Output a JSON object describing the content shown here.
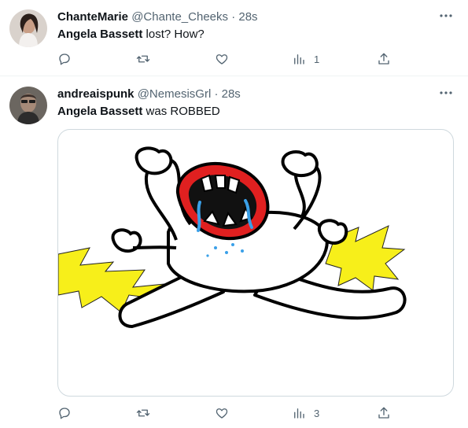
{
  "tweets": [
    {
      "display_name": "ChanteMarie",
      "handle": "@Chante_Cheeks",
      "separator": "·",
      "time": "28s",
      "text_bold": "Angela Bassett",
      "text_rest": " lost? How?",
      "avatar_icon": "user-avatar-photo",
      "views": "1"
    },
    {
      "display_name": "andreaispunk",
      "handle": "@NemesisGrl",
      "separator": "·",
      "time": "28s",
      "text_bold": "Angela Bassett",
      "text_rest": " was ROBBED",
      "avatar_icon": "user-avatar-photo",
      "media_icon": "crying-screaming-cartoon-drawing",
      "views": "3"
    }
  ],
  "icons": {
    "reply": "reply-icon",
    "retweet": "retweet-icon",
    "like": "heart-icon",
    "views": "views-chart-icon",
    "share": "share-icon",
    "more": "more-dots-icon"
  },
  "colors": {
    "text": "#0f1419",
    "secondary": "#536471",
    "border": "#eff3f4",
    "cartoon_red": "#e02020",
    "cartoon_yellow": "#f7ef1a",
    "tears": "#3aa0e8"
  }
}
